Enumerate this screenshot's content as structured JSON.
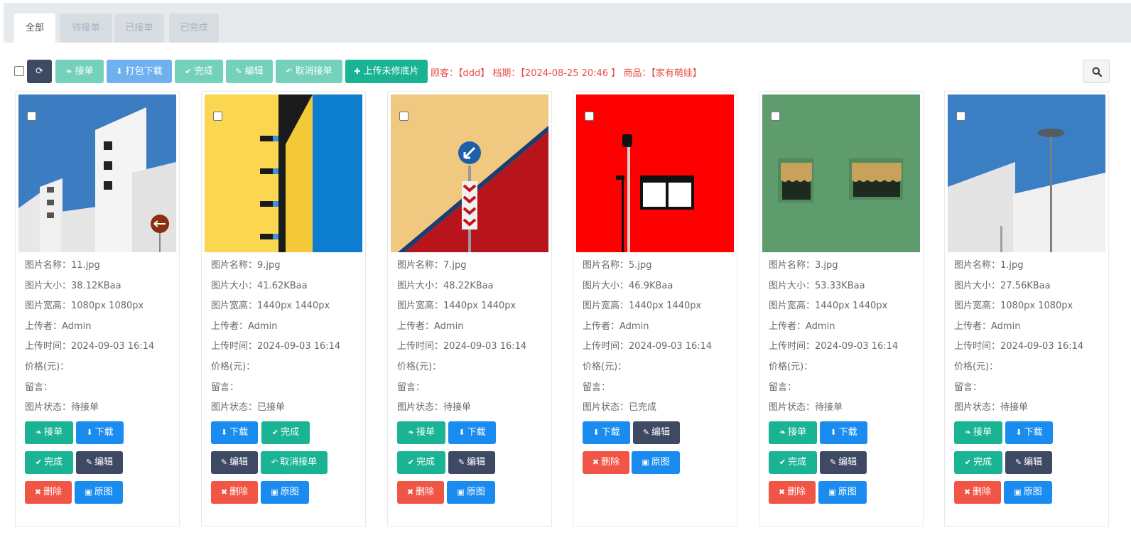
{
  "tabs": [
    {
      "label": "全部"
    },
    {
      "label": "待接单"
    },
    {
      "label": "已接单"
    },
    {
      "label": "已完成"
    }
  ],
  "toolbar": {
    "refresh_icon": "refresh-icon",
    "accept_label": "接单",
    "download_pack_label": "打包下载",
    "complete_label": "完成",
    "edit_label": "编辑",
    "cancel_accept_label": "取消接单",
    "upload_label": "上传未修底片",
    "info": {
      "customer_label": "顾客：",
      "customer_value": "【ddd】",
      "schedule_label": "档期：",
      "schedule_value": "【2024-08-25 20:46 】",
      "product_label": "商品：",
      "product_value": "【家有萌娃】"
    }
  },
  "field_labels": {
    "name": "图片名称：",
    "size": "图片大小：",
    "dims": "图片宽高：",
    "uploader": "上传者：",
    "upload_time": "上传时间：",
    "price": "价格(元)：",
    "message": "留言：",
    "status": "图片状态："
  },
  "button_labels": {
    "accept": "接单",
    "download": "下载",
    "complete": "完成",
    "edit": "编辑",
    "delete": "删除",
    "original": "原图",
    "cancel_accept": "取消接单"
  },
  "cards": [
    {
      "name": "11.jpg",
      "size": "38.12KBaa",
      "dims": "1080px 1080px",
      "uploader": "Admin",
      "upload_time": "2024-09-03 16:14",
      "price": "",
      "message": "",
      "status": "待接单"
    },
    {
      "name": "9.jpg",
      "size": "41.62KBaa",
      "dims": "1440px 1440px",
      "uploader": "Admin",
      "upload_time": "2024-09-03 16:14",
      "price": "",
      "message": "",
      "status": "已接单"
    },
    {
      "name": "7.jpg",
      "size": "48.22KBaa",
      "dims": "1440px 1440px",
      "uploader": "Admin",
      "upload_time": "2024-09-03 16:14",
      "price": "",
      "message": "",
      "status": "待接单"
    },
    {
      "name": "5.jpg",
      "size": "46.9KBaa",
      "dims": "1440px 1440px",
      "uploader": "Admin",
      "upload_time": "2024-09-03 16:14",
      "price": "",
      "message": "",
      "status": "已完成"
    },
    {
      "name": "3.jpg",
      "size": "53.33KBaa",
      "dims": "1440px 1440px",
      "uploader": "Admin",
      "upload_time": "2024-09-03 16:14",
      "price": "",
      "message": "",
      "status": "待接单"
    },
    {
      "name": "1.jpg",
      "size": "27.56KBaa",
      "dims": "1080px 1080px",
      "uploader": "Admin",
      "upload_time": "2024-09-03 16:14",
      "price": "",
      "message": "",
      "status": "待接单"
    }
  ],
  "colors": {
    "teal": "#1ab394",
    "blue": "#1c84c6",
    "navy": "#3e4a63",
    "red": "#f05545",
    "info_text": "#e8504a"
  }
}
